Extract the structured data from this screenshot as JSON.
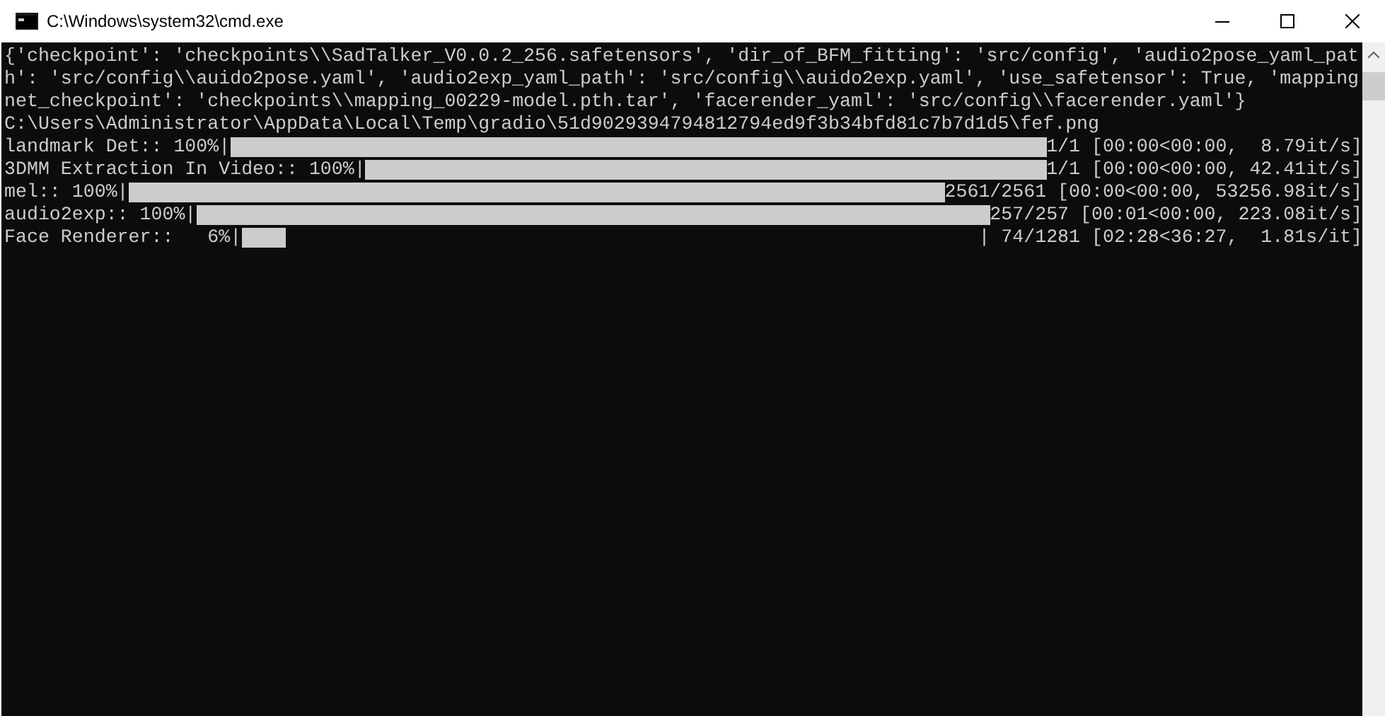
{
  "window": {
    "title": "C:\\Windows\\system32\\cmd.exe"
  },
  "console": {
    "lines": [
      "{'checkpoint': 'checkpoints\\\\SadTalker_V0.0.2_256.safetensors', 'dir_of_BFM_fitting': 'src/config', 'audio2pose_yaml_pat",
      "h': 'src/config\\\\auido2pose.yaml', 'audio2exp_yaml_path': 'src/config\\\\auido2exp.yaml', 'use_safetensor': True, 'mapping",
      "net_checkpoint': 'checkpoints\\\\mapping_00229-model.pth.tar', 'facerender_yaml': 'src/config\\\\facerender.yaml'}",
      "C:\\Users\\Administrator\\AppData\\Local\\Temp\\gradio\\51d9029394794812794ed9f3b34bfd81c7b7d1d5\\fef.png"
    ],
    "progress": [
      {
        "label": "landmark Det:: 100%|",
        "level": 1,
        "stats": "1/1 [00:00<00:00,  8.79it/s]"
      },
      {
        "label": "3DMM Extraction In Video:: 100%|",
        "level": 1,
        "stats": "1/1 [00:00<00:00, 42.41it/s]"
      },
      {
        "label": "mel:: 100%|",
        "level": 1,
        "stats": "2561/2561 [00:00<00:00, 53256.98it/s]"
      },
      {
        "label": "audio2exp:: 100%|",
        "level": 1,
        "stats": "257/257 [00:01<00:00, 223.08it/s]"
      },
      {
        "label": "Face Renderer::   6%|",
        "level": 0.06,
        "stats": "| 74/1281 [02:28<36:27,  1.81s/it]"
      }
    ]
  }
}
